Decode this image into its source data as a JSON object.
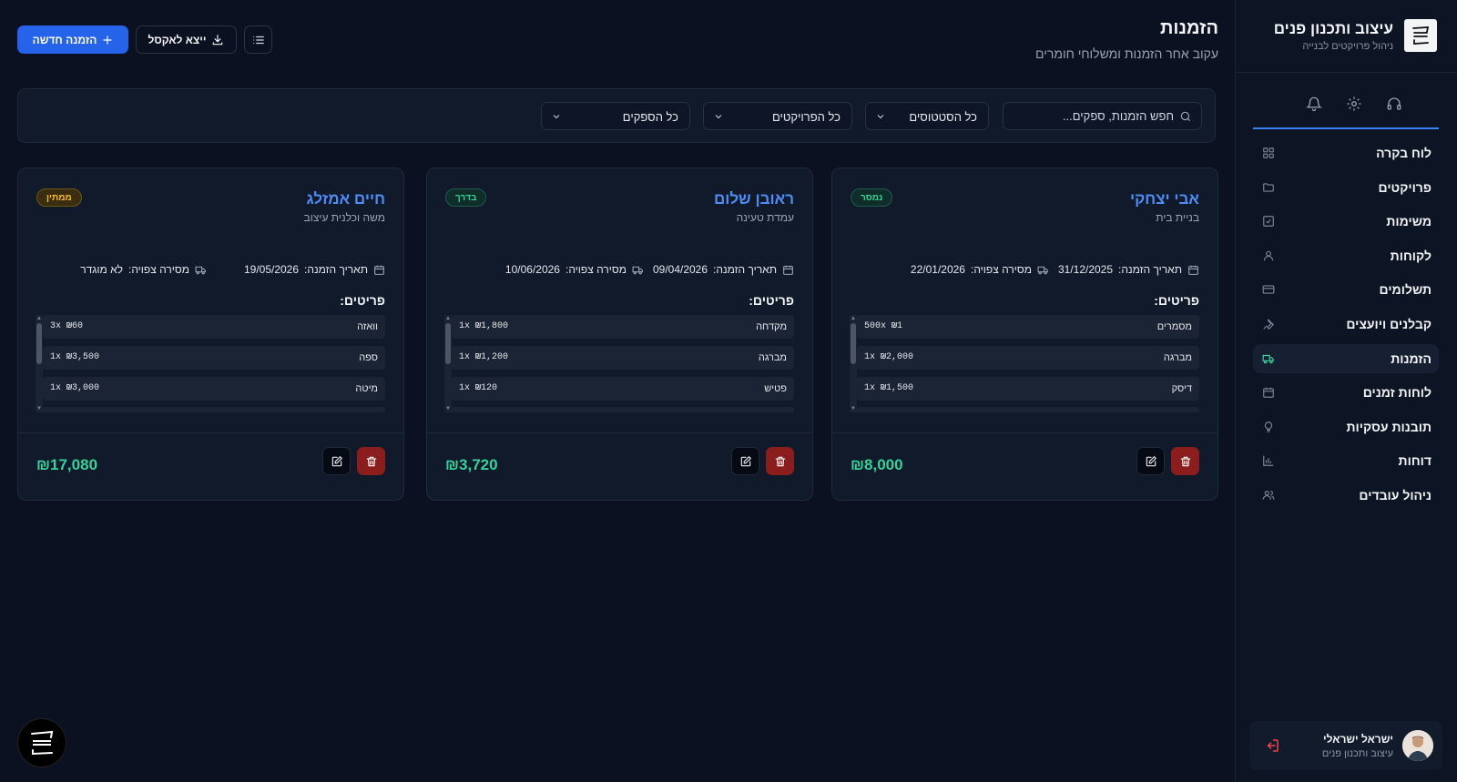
{
  "brand": {
    "title": "עיצוב ותכנון פנים",
    "subtitle": "ניהול פרויקטים לבנייה"
  },
  "sidebar": {
    "top_icons": [
      "headset-icon",
      "gear-icon",
      "bell-icon"
    ],
    "items": [
      {
        "label": "לוח בקרה",
        "icon": "grid-icon",
        "active": false
      },
      {
        "label": "פרויקטים",
        "icon": "folder-icon",
        "active": false
      },
      {
        "label": "משימות",
        "icon": "checkbox-icon",
        "active": false
      },
      {
        "label": "לקוחות",
        "icon": "user-icon",
        "active": false
      },
      {
        "label": "תשלומים",
        "icon": "credit-card-icon",
        "active": false
      },
      {
        "label": "קבלנים ויועצים",
        "icon": "wrench-icon",
        "active": false
      },
      {
        "label": "הזמנות",
        "icon": "truck-icon",
        "active": true
      },
      {
        "label": "לוחות זמנים",
        "icon": "calendar-icon",
        "active": false
      },
      {
        "label": "תובנות עסקיות",
        "icon": "lightbulb-icon",
        "active": false
      },
      {
        "label": "דוחות",
        "icon": "bar-chart-icon",
        "active": false
      },
      {
        "label": "ניהול עובדים",
        "icon": "users-icon",
        "active": false
      }
    ],
    "user": {
      "name": "ישראל ישראלי",
      "role": "עיצוב ותכנון פנים"
    }
  },
  "header": {
    "title": "הזמנות",
    "subtitle": "עקוב אחר הזמנות ומשלוחי חומרים",
    "new_button": "הזמנה חדשה",
    "export_button": "ייצא לאקסל"
  },
  "filters": {
    "search_placeholder": "חפש הזמנות, ספקים...",
    "status": "כל הסטטוסים",
    "projects": "כל הפרויקטים",
    "suppliers": "כל הספקים"
  },
  "labels": {
    "order_date": "תאריך הזמנה:",
    "expected_delivery": "מסירה צפויה:",
    "items": "פריטים:"
  },
  "orders": [
    {
      "supplier": "אבי יצחקי",
      "project": "בניית בית",
      "status": "נמסר",
      "status_color": "#34d399",
      "order_date": "31/12/2025",
      "delivery": "22/01/2026",
      "items": [
        {
          "name": "מסמרים",
          "qty": "500x",
          "price": "₪1"
        },
        {
          "name": "מברגה",
          "qty": "1x",
          "price": "₪2,000"
        },
        {
          "name": "דיסק",
          "qty": "1x",
          "price": "₪1,500"
        }
      ],
      "total": "₪8,000"
    },
    {
      "supplier": "ראובן שלום",
      "project": "עמדת טעינה",
      "status": "בדרך",
      "status_color": "#34d399",
      "order_date": "09/04/2026",
      "delivery": "10/06/2026",
      "items": [
        {
          "name": "מקדחה",
          "qty": "1x",
          "price": "₪1,800"
        },
        {
          "name": "מברגה",
          "qty": "1x",
          "price": "₪1,200"
        },
        {
          "name": "פטיש",
          "qty": "1x",
          "price": "₪120"
        }
      ],
      "total": "₪3,720"
    },
    {
      "supplier": "חיים אמזלג",
      "project": "משה וכלנית עיצוב",
      "status": "ממתין",
      "status_color": "#fbbf24",
      "order_date": "19/05/2026",
      "delivery": "לא מוגדר",
      "items": [
        {
          "name": "וואזה",
          "qty": "3x",
          "price": "₪60"
        },
        {
          "name": "ספה",
          "qty": "1x",
          "price": "₪3,500"
        },
        {
          "name": "מיטה",
          "qty": "1x",
          "price": "₪3,000"
        }
      ],
      "total": "₪17,080"
    }
  ],
  "colors": {
    "accent": "#2563eb",
    "background": "#0b1120",
    "panel": "#111a2b",
    "link": "#4f8df5",
    "success": "#34d399",
    "danger": "#8b1d1d"
  }
}
